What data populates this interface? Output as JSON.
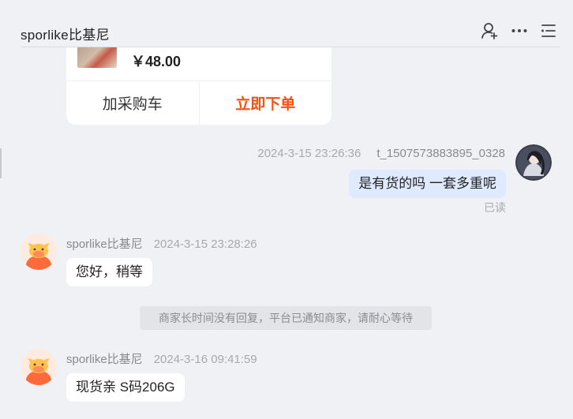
{
  "header": {
    "title": "sporlike比基尼",
    "icons": [
      "user-add-icon",
      "more-icon",
      "menu-icon"
    ]
  },
  "product_card": {
    "price": "￥48.00",
    "add_to_cart_label": "加采购车",
    "buy_now_label": "立即下单",
    "buy_color": "#ff4d0f"
  },
  "messages": [
    {
      "sender": "t_1507573883895_0328",
      "time": "2024-3-15 23:26:36",
      "text": "是有货的吗 一套多重呢",
      "status": "已读",
      "mine": true
    },
    {
      "sender": "sporlike比基尼",
      "time": "2024-3-15 23:28:26",
      "text": "您好，稍等",
      "mine": false
    },
    {
      "sender": "sporlike比基尼",
      "time": "2024-3-16 09:41:59",
      "text": "现货亲 S码206G",
      "mine": false
    }
  ],
  "system_note": "商家长时间没有回复，平台已通知商家，请耐心等待"
}
